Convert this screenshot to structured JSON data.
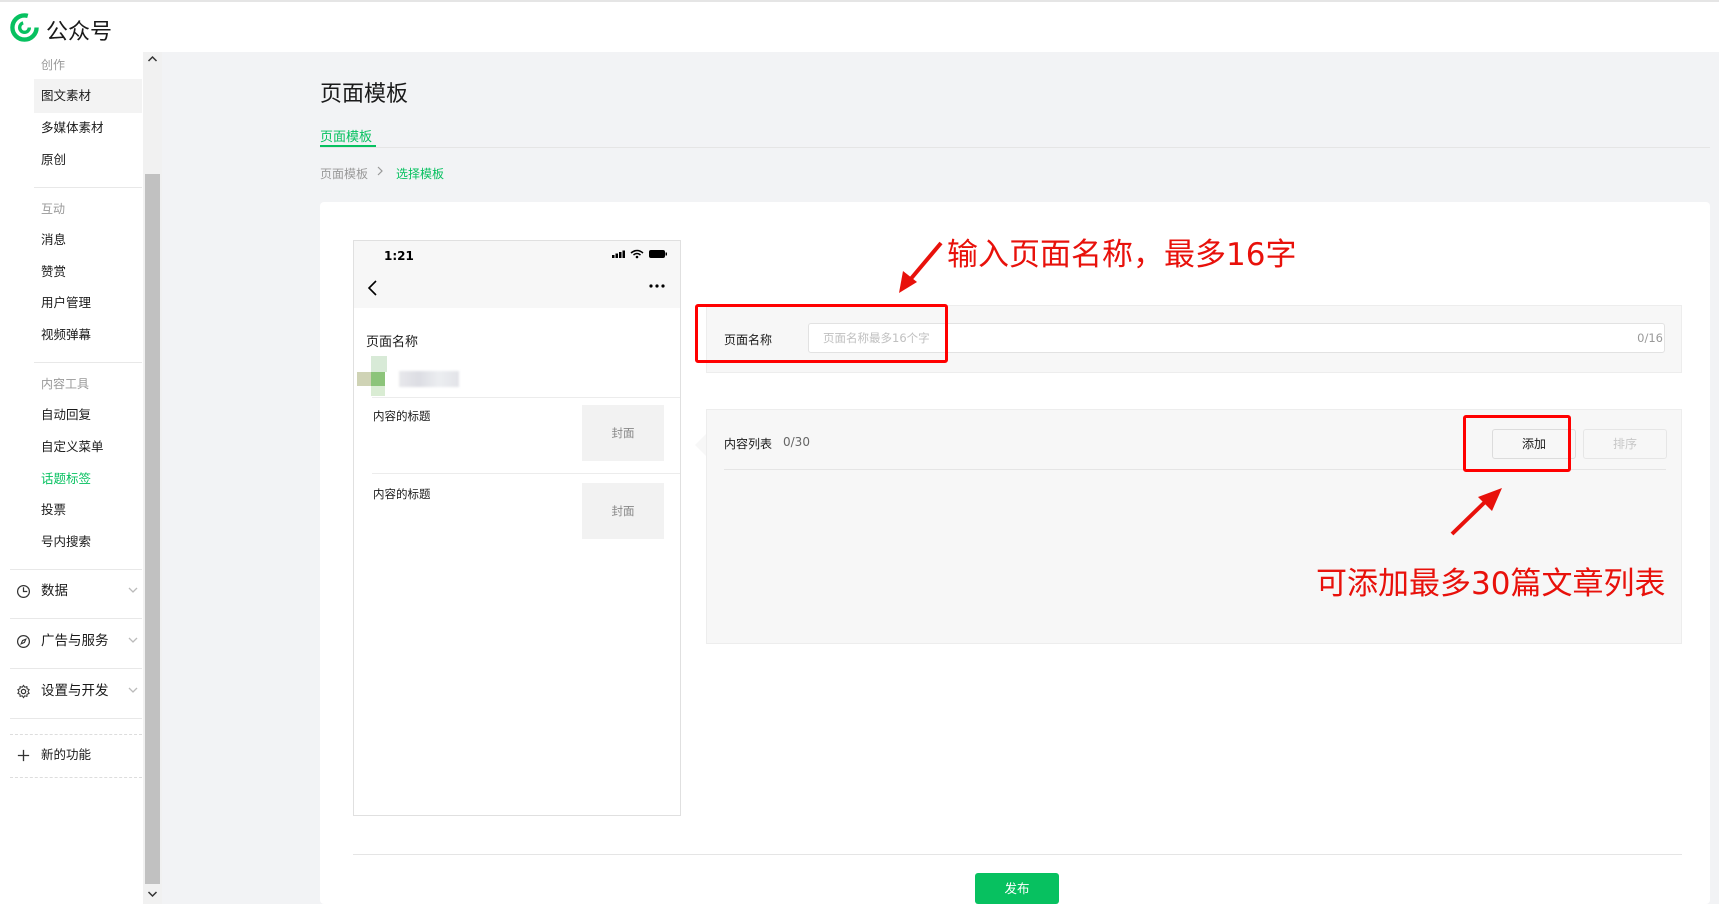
{
  "app": {
    "brand": "公众号",
    "logo_icon": "wechat-mp-logo-icon",
    "accent": "#07c160",
    "annotation_color": "#e8110b"
  },
  "sidebar": {
    "sections": [
      {
        "label": "创作",
        "items": [
          "图文素材",
          "多媒体素材",
          "原创"
        ]
      },
      {
        "label": "互动",
        "items": [
          "消息",
          "赞赏",
          "用户管理",
          "视频弹幕"
        ]
      },
      {
        "label": "内容工具",
        "items": [
          "自动回复",
          "自定义菜单",
          "话题标签",
          "投票",
          "号内搜索"
        ]
      }
    ],
    "selected_item": "图文素材",
    "active_item": "话题标签",
    "groups": [
      {
        "label": "数据",
        "icon": "pie-chart-icon"
      },
      {
        "label": "广告与服务",
        "icon": "compass-icon"
      },
      {
        "label": "设置与开发",
        "icon": "gear-icon"
      }
    ],
    "new_feature": {
      "label": "新的功能",
      "icon": "plus-icon"
    }
  },
  "main": {
    "title": "页面模板",
    "tab": "页面模板",
    "breadcrumb": [
      "页面模板",
      "选择模板"
    ]
  },
  "phone": {
    "time": "1:21",
    "page_name": "页面名称",
    "items": [
      {
        "title": "内容的标题",
        "cover": "封面"
      },
      {
        "title": "内容的标题",
        "cover": "封面"
      }
    ]
  },
  "form": {
    "name_label": "页面名称",
    "name_placeholder": "页面名称最多16个字",
    "name_value": "",
    "name_count": "0/16",
    "list_label": "内容列表",
    "list_count": "0/30",
    "add_button": "添加",
    "sort_button": "排序",
    "publish_button": "发布"
  },
  "annotations": {
    "name_hint": "输入页面名称，最多16字",
    "list_hint": "可添加最多30篇文章列表"
  }
}
